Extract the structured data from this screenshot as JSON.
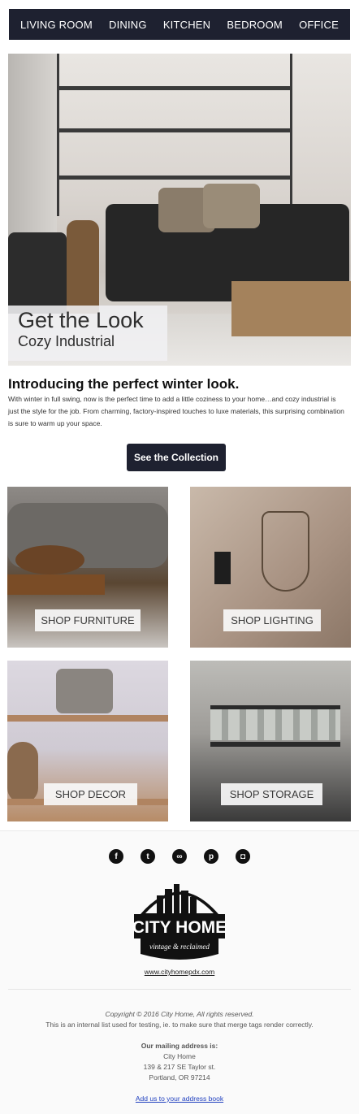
{
  "nav": {
    "items": [
      "LIVING ROOM",
      "DINING",
      "KITCHEN",
      "BEDROOM",
      "OFFICE"
    ]
  },
  "hero": {
    "title": "Get the Look",
    "subtitle": "Cozy Industrial"
  },
  "intro": {
    "heading": "Introducing the perfect winter look.",
    "body": "With winter in full swing, now is the perfect time to add a little coziness to your home…and cozy industrial is just the style for the job. From charming, factory-inspired touches to luxe materials, this surprising combination is sure to warm up your space.",
    "cta_label": "See the Collection"
  },
  "tiles": [
    {
      "label": "SHOP FURNITURE"
    },
    {
      "label": "SHOP LIGHTING"
    },
    {
      "label": "SHOP DECOR"
    },
    {
      "label": "SHOP STORAGE"
    }
  ],
  "social": {
    "icons": [
      "facebook-icon",
      "twitter-icon",
      "link-icon",
      "pinterest-icon",
      "instagram-icon"
    ],
    "glyphs": [
      "f",
      "t",
      "∞",
      "p",
      "◘"
    ]
  },
  "logo": {
    "name": "CITY HOME",
    "tagline": "vintage & reclaimed"
  },
  "footer": {
    "website": "www.cityhomepdx.com",
    "copyright": "Copyright © 2016 City Home, All rights reserved.",
    "list_note": "This is an internal list used for testing, ie. to make sure that merge tags render correctly.",
    "mailing_heading": "Our mailing address is:",
    "address_name": "City Home",
    "address_street": "139 & 217 SE Taylor st.",
    "address_city": "Portland, OR 97214",
    "address_book_link": "Add us to your address book"
  },
  "colors": {
    "navy": "#1e2130",
    "link_blue": "#1f3fbf"
  }
}
